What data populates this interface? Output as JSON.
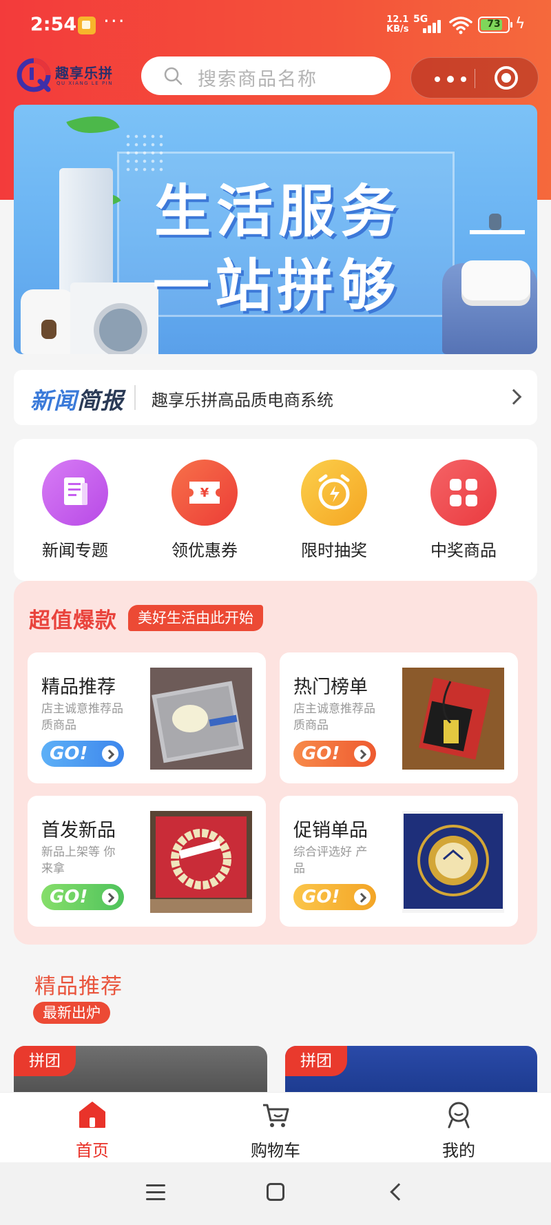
{
  "status_bar": {
    "time": "2:54",
    "dots": "···",
    "net_speed": "12.1",
    "net_unit": "KB/s",
    "network": "5G",
    "battery": "73"
  },
  "header": {
    "logo_title": "趣享乐拼",
    "logo_sub": "QU XIANG LE PIN",
    "search_placeholder": "搜索商品名称"
  },
  "banner": {
    "line1": "生活服务",
    "line2": "一站拼够"
  },
  "news": {
    "tag_part1": "新闻",
    "tag_part2": "简报",
    "text": "趣享乐拼高品质电商系统"
  },
  "quick_menu": [
    {
      "label": "新闻专题",
      "icon": "document-icon",
      "color": "#c95cf0"
    },
    {
      "label": "领优惠券",
      "icon": "coupon-icon",
      "color": "#f2583f"
    },
    {
      "label": "限时抽奖",
      "icon": "alarm-clock-icon",
      "color": "#f7b731"
    },
    {
      "label": "中奖商品",
      "icon": "grid-icon",
      "color": "#f0464a"
    }
  ],
  "deals": {
    "title": "超值爆款",
    "badge": "美好生活由此开始",
    "go_label": "GO!",
    "cards": [
      {
        "title": "精品推荐",
        "sub": "店主诚意推荐品质商品",
        "go_color": "#4c9af2"
      },
      {
        "title": "热门榜单",
        "sub": "店主诚意推荐品质商品",
        "go_color": "#f2643a"
      },
      {
        "title": "首发新品",
        "sub": "新品上架等 你来拿",
        "go_color": "#6fd06a"
      },
      {
        "title": "促销单品",
        "sub": "综合评选好 产品",
        "go_color": "#f5b32e"
      }
    ]
  },
  "featured": {
    "title": "精品推荐",
    "badge": "最新出炉",
    "product_tag": "拼团"
  },
  "tabbar": [
    {
      "label": "首页",
      "icon": "home-icon",
      "active": true
    },
    {
      "label": "购物车",
      "icon": "cart-icon",
      "active": false
    },
    {
      "label": "我的",
      "icon": "user-icon",
      "active": false
    }
  ]
}
